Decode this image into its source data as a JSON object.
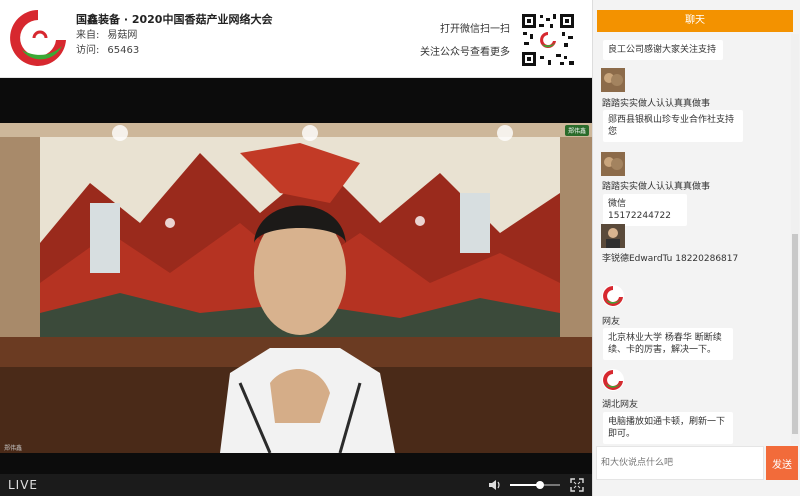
{
  "header": {
    "title": "国鑫装备 · 2020中国香菇产业网络大会",
    "source_label": "来自:",
    "source_value": "易菇网",
    "visits_label": "访问:",
    "visits_value": "65463",
    "scan_text": "打开微信扫一扫",
    "follow_text": "关注公众号查看更多"
  },
  "video": {
    "cam_badge": "郑伟鑫",
    "cam_label": "郑伟鑫"
  },
  "controls": {
    "live_label": "LIVE",
    "volume_level": 0.6
  },
  "chat": {
    "title": "聊天",
    "messages": [
      {
        "user": "",
        "text": "良工公司感谢大家关注支持"
      },
      {
        "user": "踏踏实实做人认认真真做事",
        "text": "郧西县银枫山珍专业合作社支持您"
      },
      {
        "user": "踏踏实实做人认认真真做事",
        "text": "微信15172244722"
      },
      {
        "user": "李锐德EdwardTu",
        "text": "18220286817"
      },
      {
        "user": "网友",
        "text": "北京林业大学 杨春华 断断续续、卡的厉害，解决一下。"
      },
      {
        "user": "湖北网友",
        "text": "电脑播放如通卡顿，刷新一下即可。"
      }
    ],
    "input_placeholder": "和大伙说点什么吧",
    "send_label": "发送"
  },
  "colors": {
    "accent": "#f39200",
    "send": "#f26b3a",
    "logo_red": "#d7282f",
    "logo_green": "#3aa935"
  }
}
